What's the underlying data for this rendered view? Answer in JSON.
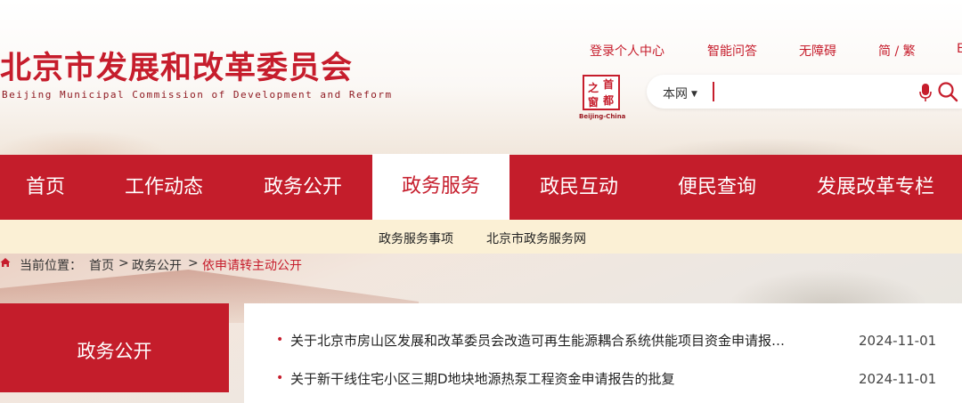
{
  "header": {
    "title": "北京市发展和改革委员会",
    "subtitle": "Beijing Municipal Commission of Development and Reform",
    "top_links": [
      "登录个人中心",
      "智能问答",
      "无障碍",
      "简 / 繁",
      "EN"
    ],
    "seal": {
      "chars": [
        "首",
        "都",
        "之",
        "窗"
      ],
      "caption": "Beijing-China"
    }
  },
  "search": {
    "scope": "本网",
    "value": "",
    "placeholder": ""
  },
  "nav": {
    "items": [
      "首页",
      "工作动态",
      "政务公开",
      "政务服务",
      "政民互动",
      "便民查询",
      "发展改革专栏"
    ],
    "active_index": 3
  },
  "subnav": {
    "items": [
      "政务服务事项",
      "北京市政务服务网"
    ]
  },
  "breadcrumb": {
    "prefix": "当前位置：",
    "items": [
      "首页",
      "政务公开",
      "依申请转主动公开"
    ],
    "separator": ">"
  },
  "side": {
    "title": "政务公开"
  },
  "list": {
    "items": [
      {
        "title": "关于北京市房山区发展和改革委员会改造可再生能源耦合系统供能项目资金申请报告的批复",
        "date": "2024-11-01"
      },
      {
        "title": "关于新干线住宅小区三期D地块地源热泵工程资金申请报告的批复",
        "date": "2024-11-01"
      }
    ]
  },
  "colors": {
    "brand_red": "#c41d2b",
    "subnav_bg": "#fbf0d5"
  }
}
